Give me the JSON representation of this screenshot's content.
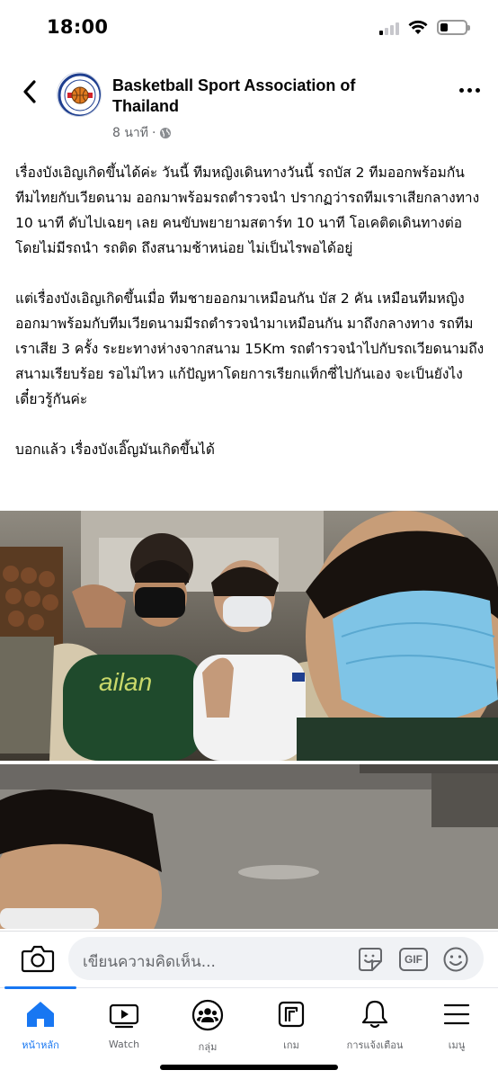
{
  "status_bar": {
    "time": "18:00"
  },
  "post": {
    "page_name": "Basketball Sport Association of Thailand",
    "timestamp": "8 นาที",
    "separator": "·",
    "paragraphs": [
      "เรื่องบังเอิญเกิดขึ้นได้ค่ะ วันนี้ ทีมหญิงเดินทางวันนี้ รถบัส 2 ทีมออกพร้อมกัน ทีมไทยกับเวียดนาม ออกมาพร้อมรถตำรวจนำ ปรากฏว่ารถทีมเราเสียกลางทาง 10 นาที ดับไปเฉยๆ เลย คนขับพยายามสตาร์ท 10 นาที โอเคติดเดินทางต่อโดยไม่มีรถนำ รถติด ถึงสนามช้าหน่อย ไม่เป็นไรพอได้อยู่",
      "แต่เรื่องบังเอิญเกิดขึ้นเมื่อ ทีมชายออกมาเหมือนกัน บัส 2 คัน เหมือนทีมหญิง ออกมาพร้อมกับทีมเวียดนามมีรถตำรวจนำมาเหมือนกัน มาถึงกลางทาง รถทีมเราเสีย 3 ครั้ง ระยะทางห่างจากสนาม 15Km รถตำรวจนำไปกับรถเวียดนามถึงสนามเรียบร้อย รอไม่ไหว แก้ปัญหาโดยการเรียกแท็กซี่ไปกันเอง จะเป็นยังไงเดี๋ยวรู้กันค่ะ",
      "บอกแล้ว เรื่องบังเอิ๊ญมันเกิดขึ้นได้"
    ]
  },
  "comment_bar": {
    "placeholder": "เขียนความคิดเห็น...",
    "gif_label": "GIF"
  },
  "bottom_nav": {
    "items": [
      {
        "label": "หน้าหลัก",
        "icon": "home-icon",
        "active": true
      },
      {
        "label": "Watch",
        "icon": "watch-icon",
        "active": false
      },
      {
        "label": "กลุ่ม",
        "icon": "groups-icon",
        "active": false
      },
      {
        "label": "เกม",
        "icon": "gaming-icon",
        "active": false
      },
      {
        "label": "การแจ้งเตือน",
        "icon": "bell-icon",
        "active": false
      },
      {
        "label": "เมนู",
        "icon": "menu-icon",
        "active": false
      }
    ]
  },
  "colors": {
    "accent": "#1877f2",
    "secondary_text": "#65676b",
    "input_bg": "#f0f2f5"
  }
}
